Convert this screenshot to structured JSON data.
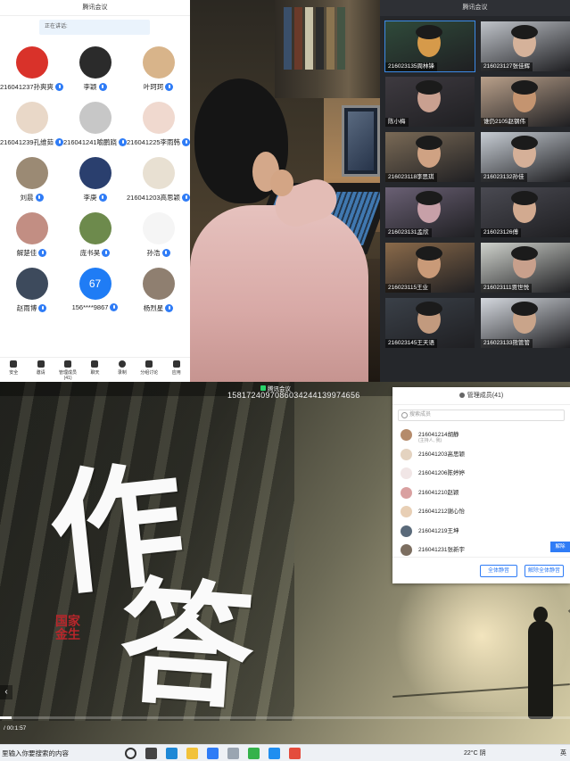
{
  "panel1": {
    "title": "腾讯会议",
    "speaking": "正在讲话:",
    "participants": [
      {
        "name": "216041237孙爽爽",
        "color": "#d9322a"
      },
      {
        "name": "李颖",
        "color": "#2b2b2b"
      },
      {
        "name": "叶珂珂",
        "color": "#d8b48a"
      },
      {
        "name": "216041239孔维茹",
        "color": "#e9d8c8"
      },
      {
        "name": "216041241喻鹏跷",
        "color": "#c7c7c7"
      },
      {
        "name": "216041225李雨韩",
        "color": "#f0d9cf"
      },
      {
        "name": "刘晨",
        "color": "#9b8a74"
      },
      {
        "name": "李庚",
        "color": "#2a3f6e"
      },
      {
        "name": "216041203高思颖",
        "color": "#e8e0d2"
      },
      {
        "name": "解楚佳",
        "color": "#c28e83"
      },
      {
        "name": "庞书昊",
        "color": "#6d8a4c"
      },
      {
        "name": "孙浩",
        "color": "#f5f5f5"
      },
      {
        "name": "赵雨博",
        "color": "#3d4a5c"
      },
      {
        "name": "156****9867",
        "color": "#1f7cf5",
        "text": "67"
      },
      {
        "name": "杨烈星",
        "color": "#8f7f70"
      }
    ],
    "toolbar": [
      "安全",
      "邀请",
      "管理成员(41)",
      "聊天",
      "录制",
      "分组讨论",
      "应用"
    ]
  },
  "panel3": {
    "title": "腾讯会议",
    "tiles": [
      {
        "label": "216023135周林锋",
        "bg": "#2f4a3a",
        "face": "#d69a4a"
      },
      {
        "label": "216023127张佳辉",
        "bg": "#bfc3c9",
        "face": "#d5b29a"
      },
      {
        "label": "陈小梅",
        "bg": "#3e3a40",
        "face": "#c9a090"
      },
      {
        "label": "谁仍2105赵钢伟",
        "bg": "#b9a08a",
        "face": "#c49470"
      },
      {
        "label": "216023118李思琪",
        "bg": "#7a6a56",
        "face": "#cfa283"
      },
      {
        "label": "216023132孙佳",
        "bg": "#c7cdd4",
        "face": "#d5b098"
      },
      {
        "label": "216023131孟欣",
        "bg": "#6a6074",
        "face": "#c7a0a8"
      },
      {
        "label": "216023126傅",
        "bg": "#4a4a52",
        "face": "#d2aa90"
      },
      {
        "label": "216023115王业",
        "bg": "#8a6a4a",
        "face": "#c99a78"
      },
      {
        "label": "216023111贾世悦",
        "bg": "#cfd2cc",
        "face": "#c8a08c"
      },
      {
        "label": "216023145王天语",
        "bg": "#3a4048",
        "face": "#c29a7e"
      },
      {
        "label": "216023133熊管管",
        "bg": "#d4d8de",
        "face": "#c9a48a"
      }
    ]
  },
  "panel4": {
    "title": "腾讯会议",
    "id_text": "15817240970860342441399746​56",
    "calli1": "作",
    "calli2": "答",
    "seal": "国\n家\n金\n生",
    "time": "/ 00:1:57",
    "progress": 0.02,
    "members": {
      "title": "管理成员(41)",
      "search_placeholder": "搜索成员",
      "list": [
        {
          "name": "216041214胡静",
          "sub": "(主持人, 我)",
          "color": "#b58b6b"
        },
        {
          "name": "216041203高思颖",
          "sub": "",
          "color": "#e4d3c0"
        },
        {
          "name": "216041206陈婷婷",
          "sub": "",
          "color": "#f1e6e6"
        },
        {
          "name": "216041210赵颖",
          "sub": "",
          "color": "#d9a0a0"
        },
        {
          "name": "216041212谢心怡",
          "sub": "",
          "color": "#e8cfb5"
        },
        {
          "name": "216041219王坤",
          "sub": "",
          "color": "#5a6a7a"
        },
        {
          "name": "216041231张新宇",
          "sub": "",
          "color": "#7c6e60"
        }
      ],
      "unmute_label": "解除",
      "mute_all": "全体静音",
      "unmute_all": "解除全体静音"
    }
  },
  "taskbar": {
    "search_text": "里输入你要搜索的内容",
    "weather": "22°C 阴",
    "lang": "英",
    "icons": [
      {
        "name": "search-icon",
        "color": "#333333"
      },
      {
        "name": "task-view-icon",
        "color": "#444444"
      },
      {
        "name": "edge-icon",
        "color": "#1e88d6"
      },
      {
        "name": "file-explorer-icon",
        "color": "#f2c23a"
      },
      {
        "name": "tencent-meeting-icon",
        "color": "#2f7cf6"
      },
      {
        "name": "app-icon",
        "color": "#9aa5b1"
      },
      {
        "name": "media-player-icon",
        "color": "#35b24b"
      },
      {
        "name": "video-app-icon",
        "color": "#1f8ef0"
      },
      {
        "name": "game-app-icon",
        "color": "#e44c3c"
      }
    ]
  }
}
